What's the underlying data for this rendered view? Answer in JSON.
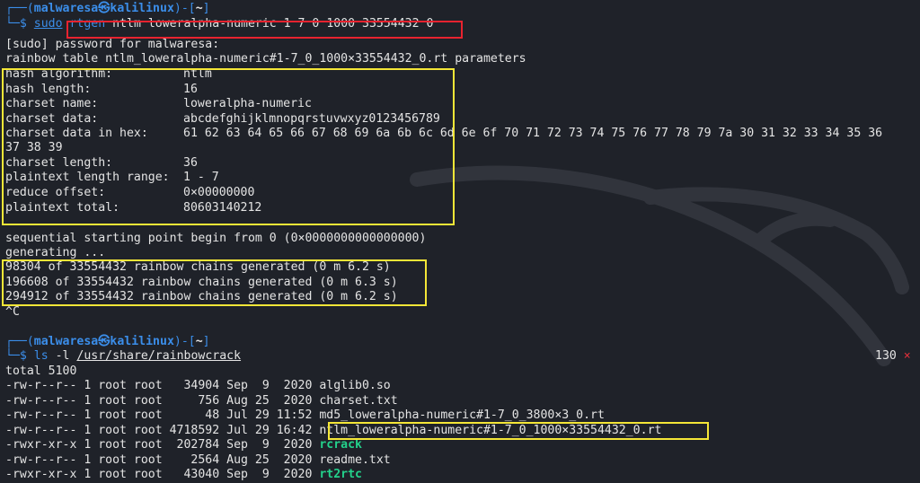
{
  "prompt1": {
    "corner": "┌──(",
    "user": "malwaresa",
    "at": "㉿",
    "host": "kalilinux",
    "mid": ")-[",
    "path": "~",
    "end": "]",
    "arrow": "└─$ ",
    "sudo": "sudo",
    "cmd": "rtgen",
    "args": " ntlm loweralpha-numeric 1 7 0 1000 33554432 0"
  },
  "sudo_password": "[sudo] password for malwaresa:",
  "rt_header": "rainbow table ntlm_loweralpha-numeric#1-7_0_1000×33554432_0.rt parameters",
  "params": [
    {
      "label": "hash algorithm:",
      "value": "ntlm"
    },
    {
      "label": "hash length:",
      "value": "16"
    },
    {
      "label": "charset name:",
      "value": "loweralpha-numeric"
    },
    {
      "label": "charset data:",
      "value": "abcdefghijklmnopqrstuvwxyz0123456789"
    },
    {
      "label": "charset data in hex:",
      "value": "61 62 63 64 65 66 67 68 69 6a 6b 6c 6d 6e 6f 70 71 72 73 74 75 76 77 78 79 7a 30 31 32 33 34 35 36"
    },
    {
      "label": "",
      "value": "37 38 39"
    },
    {
      "label": "charset length:",
      "value": "36"
    },
    {
      "label": "plaintext length range:",
      "value": "1 - 7"
    },
    {
      "label": "reduce offset:",
      "value": "0×00000000"
    },
    {
      "label": "plaintext total:",
      "value": "80603140212"
    }
  ],
  "seq_line": "sequential starting point begin from 0 (0×0000000000000000)",
  "generating": "generating ...",
  "chains": [
    "98304 of 33554432 rainbow chains generated (0 m 6.2 s)",
    "196608 of 33554432 rainbow chains generated (0 m 6.3 s)",
    "294912 of 33554432 rainbow chains generated (0 m 6.2 s)"
  ],
  "ctrl_c": "^C",
  "prompt2": {
    "corner": "┌──(",
    "user": "malwaresa",
    "at": "㉿",
    "host": "kalilinux",
    "mid": ")-[",
    "path": "~",
    "end": "]",
    "arrow": "└─$ ",
    "cmd": "ls",
    "flag": " -l ",
    "dir": "/usr/share/rainbowcrack",
    "exit_code": "130",
    "exit_icon": "×"
  },
  "total": "total 5100",
  "files": [
    {
      "meta": "-rw-r--r-- 1 root root   34904 Sep  9  2020 ",
      "name": "alglib0.so",
      "exec": false
    },
    {
      "meta": "-rw-r--r-- 1 root root     756 Aug 25  2020 ",
      "name": "charset.txt",
      "exec": false
    },
    {
      "meta": "-rw-r--r-- 1 root root      48 Jul 29 11:52 ",
      "name": "md5_loweralpha-numeric#1-7_0_3800×3_0.rt",
      "exec": false
    },
    {
      "meta": "-rw-r--r-- 1 root root 4718592 Jul 29 16:42 ",
      "name": "ntlm_loweralpha-numeric#1-7_0_1000×33554432_0.rt",
      "exec": false
    },
    {
      "meta": "-rwxr-xr-x 1 root root  202784 Sep  9  2020 ",
      "name": "rcrack",
      "exec": true
    },
    {
      "meta": "-rw-r--r-- 1 root root    2564 Aug 25  2020 ",
      "name": "readme.txt",
      "exec": false
    },
    {
      "meta": "-rwxr-xr-x 1 root root   43040 Sep  9  2020 ",
      "name": "rt2rtc",
      "exec": true
    }
  ],
  "colors": {
    "background": "#1f2229",
    "prompt": "#3b8eea",
    "exec": "#23d18b",
    "highlight_red": "#e8232f",
    "highlight_yellow": "#f4e637"
  }
}
